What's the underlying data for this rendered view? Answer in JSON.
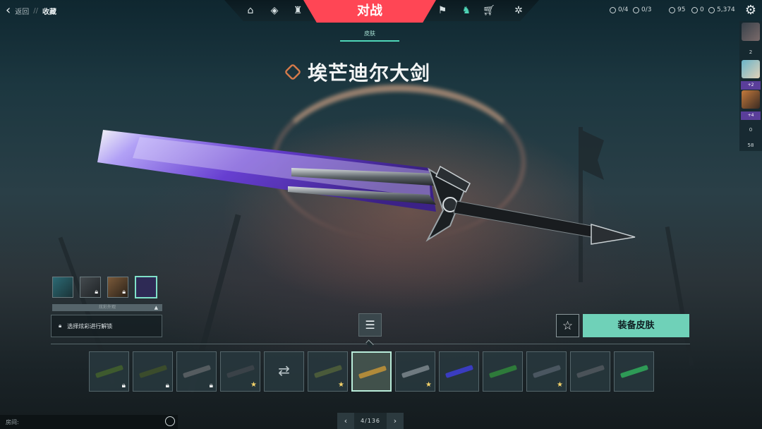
{
  "nav": {
    "back_label": "返回",
    "separator": "//",
    "breadcrumb_current": "收藏",
    "play_label": "对战",
    "icons": [
      "home-icon",
      "career-icon",
      "agents-icon",
      "battlepass-icon",
      "collection-icon",
      "store-icon",
      "social-icon"
    ]
  },
  "currency": {
    "missions": "0/4",
    "radianite_quests": "0/3",
    "valorant_points": "95",
    "radianite_points": "0",
    "kingdom_credits": "5,374"
  },
  "subtab": {
    "label": "皮肤"
  },
  "skin": {
    "name": "埃芒迪尔大剑",
    "tier_color": "#d67a4a",
    "blade_color": "#6a3fd8"
  },
  "party": {
    "count_top": "2",
    "badge_1": "+2",
    "badge_2": "+4",
    "count_1": "0",
    "count_2": "58"
  },
  "variants": {
    "header": "炫彩外观",
    "unlock_hint": "选择炫彩进行解锁",
    "selected_index": 3
  },
  "actions": {
    "equip_label": "装备皮肤"
  },
  "skins": [
    {
      "name": "skin-1",
      "status": "locked"
    },
    {
      "name": "skin-2",
      "status": "locked"
    },
    {
      "name": "skin-3",
      "status": "locked"
    },
    {
      "name": "skin-4",
      "status": "favorite"
    },
    {
      "name": "skin-5",
      "status": "random"
    },
    {
      "name": "skin-6",
      "status": "favorite"
    },
    {
      "name": "skin-7",
      "status": "selected"
    },
    {
      "name": "skin-8",
      "status": "favorite"
    },
    {
      "name": "skin-9",
      "status": ""
    },
    {
      "name": "skin-10",
      "status": ""
    },
    {
      "name": "skin-11",
      "status": "favorite"
    },
    {
      "name": "skin-12",
      "status": ""
    },
    {
      "name": "skin-13",
      "status": ""
    }
  ],
  "footer": {
    "room_label": "房间:",
    "page": "4/136"
  }
}
